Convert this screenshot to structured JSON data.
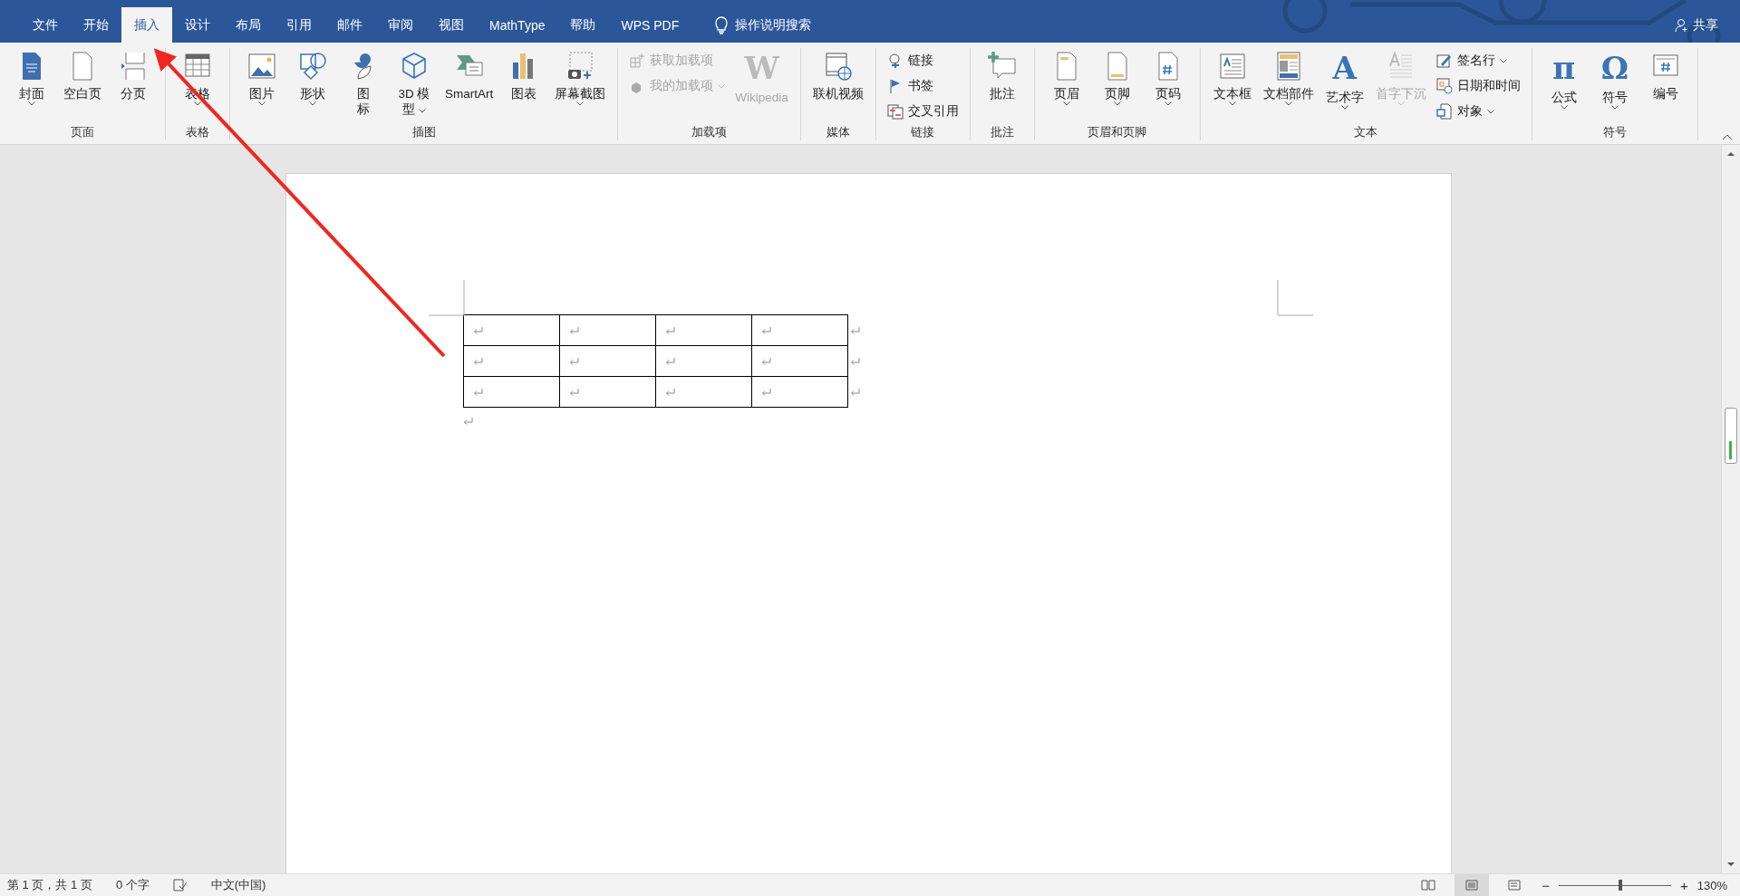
{
  "tabs": [
    {
      "label": "文件",
      "selected": false
    },
    {
      "label": "开始",
      "selected": false
    },
    {
      "label": "插入",
      "selected": true
    },
    {
      "label": "设计",
      "selected": false
    },
    {
      "label": "布局",
      "selected": false
    },
    {
      "label": "引用",
      "selected": false
    },
    {
      "label": "邮件",
      "selected": false
    },
    {
      "label": "审阅",
      "selected": false
    },
    {
      "label": "视图",
      "selected": false
    },
    {
      "label": "MathType",
      "selected": false
    },
    {
      "label": "帮助",
      "selected": false
    },
    {
      "label": "WPS PDF",
      "selected": false
    }
  ],
  "search": {
    "placeholder": "操作说明搜索"
  },
  "share": {
    "label": "共享"
  },
  "ribbon": [
    {
      "label": "页面",
      "items": [
        {
          "kind": "large",
          "label": "封面",
          "dropdown": true,
          "disabled": false
        },
        {
          "kind": "large",
          "label": "空白页",
          "dropdown": false,
          "disabled": false
        },
        {
          "kind": "large",
          "label": "分页",
          "dropdown": false,
          "disabled": false
        }
      ]
    },
    {
      "label": "表格",
      "items": [
        {
          "kind": "large",
          "label": "表格",
          "dropdown": true,
          "disabled": false
        }
      ]
    },
    {
      "label": "插图",
      "items": [
        {
          "kind": "large",
          "label": "图片",
          "dropdown": true,
          "disabled": false
        },
        {
          "kind": "large",
          "label": "形状",
          "dropdown": true,
          "disabled": false
        },
        {
          "kind": "narrow",
          "label": "图标",
          "dropdown": false,
          "disabled": false
        },
        {
          "kind": "large",
          "label": "3D 模型",
          "wrap": true,
          "dropdown": true,
          "disabled": false
        },
        {
          "kind": "large",
          "label": "SmartArt",
          "dropdown": false,
          "disabled": false
        },
        {
          "kind": "large",
          "label": "图表",
          "dropdown": false,
          "disabled": false
        },
        {
          "kind": "large",
          "label": "屏幕截图",
          "dropdown": true,
          "disabled": false
        }
      ]
    },
    {
      "label": "加载项",
      "items": [
        {
          "kind": "stack",
          "items": [
            {
              "kind": "small",
              "label": "获取加载项",
              "dropdown": false,
              "disabled": true
            },
            {
              "kind": "small",
              "label": "我的加载项",
              "dropdown": true,
              "disabled": true
            }
          ]
        },
        {
          "kind": "large",
          "label": "Wikipedia",
          "glyph": "W",
          "dropdown": false,
          "disabled": true
        }
      ]
    },
    {
      "label": "媒体",
      "items": [
        {
          "kind": "large",
          "label": "联机视频",
          "dropdown": false,
          "disabled": false
        }
      ]
    },
    {
      "label": "链接",
      "items": [
        {
          "kind": "stack",
          "items": [
            {
              "kind": "small",
              "label": "链接",
              "dropdown": false,
              "disabled": false
            },
            {
              "kind": "small",
              "label": "书签",
              "dropdown": false,
              "disabled": false
            },
            {
              "kind": "small",
              "label": "交叉引用",
              "dropdown": false,
              "disabled": false
            }
          ]
        }
      ]
    },
    {
      "label": "批注",
      "items": [
        {
          "kind": "large",
          "label": "批注",
          "dropdown": false,
          "disabled": false
        }
      ]
    },
    {
      "label": "页眉和页脚",
      "items": [
        {
          "kind": "large",
          "label": "页眉",
          "dropdown": true,
          "disabled": false
        },
        {
          "kind": "large",
          "label": "页脚",
          "dropdown": true,
          "disabled": false
        },
        {
          "kind": "large",
          "label": "页码",
          "dropdown": true,
          "disabled": false
        }
      ]
    },
    {
      "label": "文本",
      "items": [
        {
          "kind": "large",
          "label": "文本框",
          "dropdown": true,
          "disabled": false
        },
        {
          "kind": "large",
          "label": "文档部件",
          "dropdown": true,
          "disabled": false
        },
        {
          "kind": "large",
          "label": "艺术字",
          "glyph": "A",
          "dropdown": true,
          "disabled": false
        },
        {
          "kind": "large",
          "label": "首字下沉",
          "dropdown": true,
          "disabled": true
        },
        {
          "kind": "stack",
          "items": [
            {
              "kind": "small",
              "label": "签名行",
              "dropdown": true,
              "disabled": false
            },
            {
              "kind": "small",
              "label": "日期和时间",
              "dropdown": false,
              "disabled": false
            },
            {
              "kind": "small",
              "label": "对象",
              "dropdown": true,
              "disabled": false
            }
          ]
        }
      ]
    },
    {
      "label": "符号",
      "items": [
        {
          "kind": "large",
          "label": "公式",
          "glyph": "π",
          "dropdown": true,
          "disabled": false
        },
        {
          "kind": "large",
          "label": "符号",
          "glyph": "Ω",
          "dropdown": true,
          "disabled": false
        },
        {
          "kind": "large",
          "label": "编号",
          "dropdown": false,
          "disabled": false
        }
      ]
    }
  ],
  "status_bar": {
    "page": "第 1 页，共 1 页",
    "words": "0 个字",
    "language": "中文(中国)",
    "views": [
      {
        "selected": false
      },
      {
        "selected": true
      },
      {
        "selected": false
      }
    ],
    "zoom_out": "−",
    "zoom_in": "+",
    "zoom": {
      "level": 0.55
    },
    "zoom_reading": "130%"
  }
}
